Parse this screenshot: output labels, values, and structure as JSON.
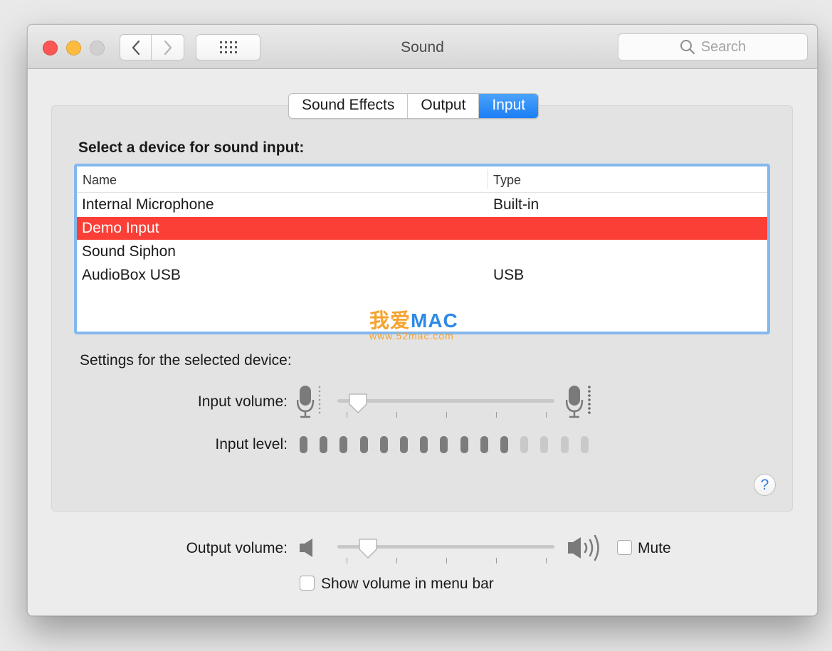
{
  "window": {
    "title": "Sound"
  },
  "toolbar": {
    "search_placeholder": "Search"
  },
  "tabs": [
    {
      "label": "Sound Effects",
      "active": false
    },
    {
      "label": "Output",
      "active": false
    },
    {
      "label": "Input",
      "active": true
    }
  ],
  "input": {
    "section_title": "Select a device for sound input:",
    "columns": {
      "name": "Name",
      "type": "Type"
    },
    "devices": [
      {
        "name": "Internal Microphone",
        "type": "Built-in",
        "selected": false
      },
      {
        "name": "Demo Input",
        "type": "",
        "selected": true
      },
      {
        "name": "Sound Siphon",
        "type": "",
        "selected": false
      },
      {
        "name": "AudioBox USB",
        "type": "USB",
        "selected": false
      }
    ],
    "settings_label": "Settings for the selected device:",
    "volume_label": "Input volume:",
    "volume_value": 0.05,
    "level_label": "Input level:",
    "level_total": 15,
    "level_active": 11
  },
  "watermark": {
    "brand_cn": "我爱",
    "brand_en": "MAC",
    "url": "www.52mac.com"
  },
  "output": {
    "volume_label": "Output volume:",
    "volume_value": 0.1,
    "mute_label": "Mute",
    "mute_checked": false,
    "show_in_menu_label": "Show volume in menu bar",
    "show_in_menu_checked": false
  },
  "help": {
    "label": "?"
  },
  "colors": {
    "accent": "#1c7ef5",
    "selection": "#fb3e36",
    "close": "#fc5753",
    "minimize": "#fdbc40",
    "level_on": "#7c7c7c",
    "level_off": "#c9c9c9"
  }
}
